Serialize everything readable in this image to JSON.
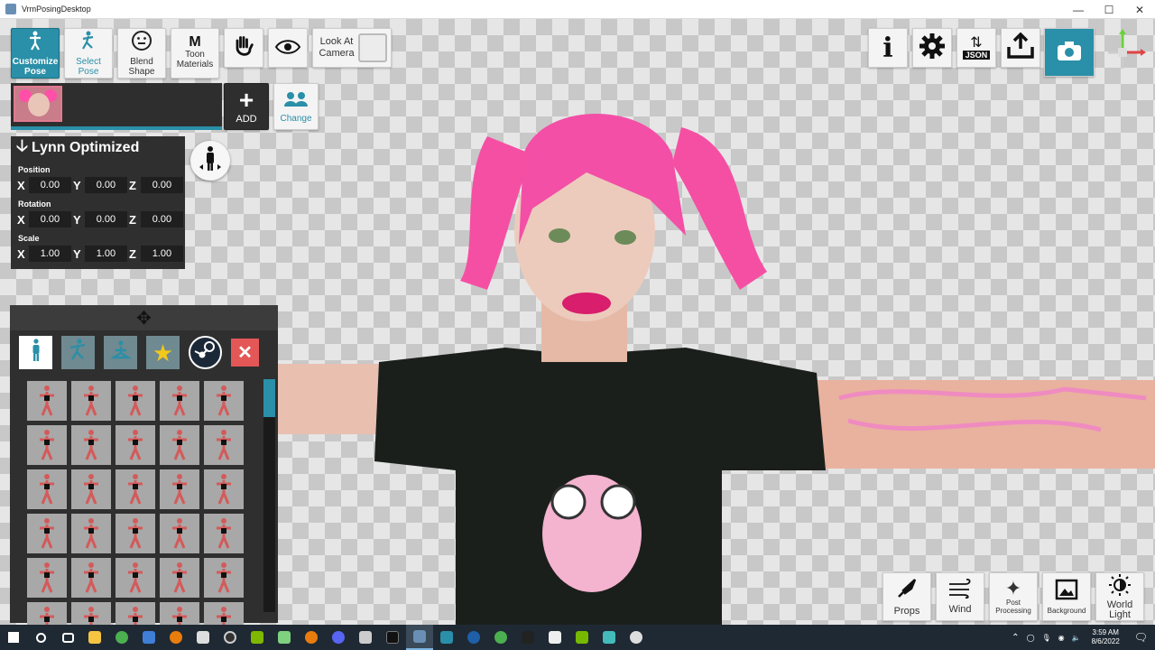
{
  "window": {
    "title": "VrmPosingDesktop"
  },
  "toolbar": {
    "customize_pose": "Customize Pose",
    "select_pose": "Select Pose",
    "blend_shape": "Blend Shape",
    "toon_materials_m": "M",
    "toon_materials": "Toon Materials",
    "look_at_camera": "Look At Camera"
  },
  "actions": {
    "add": "ADD",
    "change": "Change"
  },
  "transform": {
    "model_name": "Lynn Optimized",
    "position_label": "Position",
    "rotation_label": "Rotation",
    "scale_label": "Scale",
    "axes": [
      "X",
      "Y",
      "Z"
    ],
    "position": [
      "0.00",
      "0.00",
      "0.00"
    ],
    "rotation": [
      "0.00",
      "0.00",
      "0.00"
    ],
    "scale": [
      "1.00",
      "1.00",
      "1.00"
    ]
  },
  "right_toolbar": {
    "json_label": "JSON"
  },
  "bottom_toolbar": {
    "props": "Props",
    "wind": "Wind",
    "post_processing": "Post Processing",
    "background": "Background",
    "world_light": "World Light"
  },
  "taskbar": {
    "time": "3:59 AM",
    "date": "8/6/2022"
  },
  "colors": {
    "accent": "#2a8fa8",
    "panel": "#2f2f2f",
    "close": "#e45757"
  }
}
